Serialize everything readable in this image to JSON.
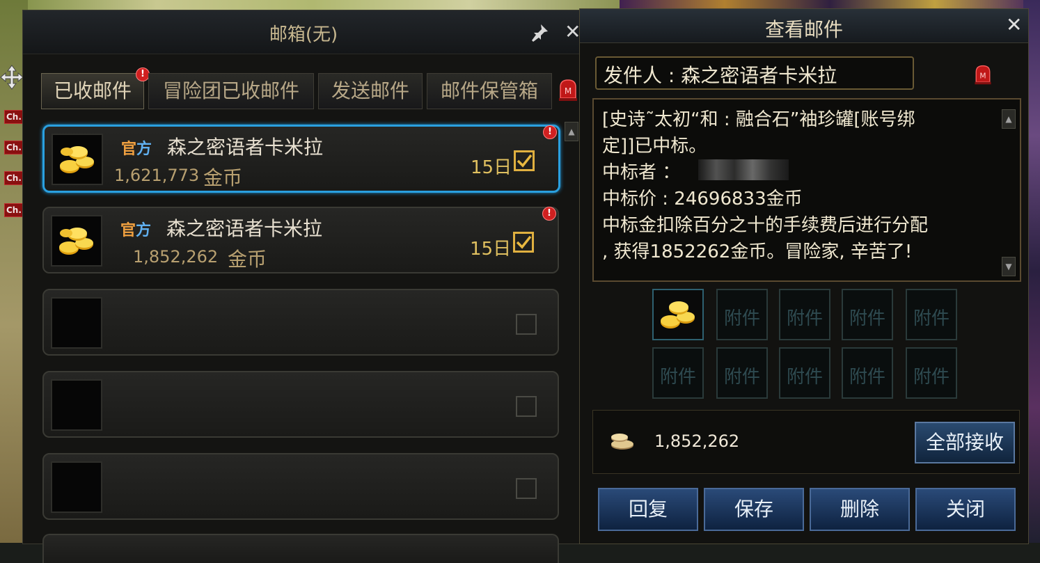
{
  "left_tags": [
    "Ch.",
    "Ch.",
    "Ch.",
    "Ch."
  ],
  "mailbox": {
    "title": "邮箱(无)",
    "tabs": [
      {
        "label": "已收邮件",
        "active": true,
        "badge": "!"
      },
      {
        "label": "冒险团已收邮件",
        "active": false
      },
      {
        "label": "发送邮件",
        "active": false
      },
      {
        "label": "邮件保管箱",
        "active": false
      }
    ],
    "mails": [
      {
        "official_a": "官",
        "official_b": "方",
        "sender": "森之密语者卡米拉",
        "amount": "1,621,773",
        "unit": "金币",
        "days": "15日",
        "badge": "!",
        "selected": true
      },
      {
        "official_a": "官",
        "official_b": "方",
        "sender": "森之密语者卡米拉",
        "amount": "1,852,262",
        "unit": "金币",
        "days": "15日",
        "badge": "!",
        "selected": false
      }
    ]
  },
  "viewmail": {
    "title": "查看邮件",
    "sender_label": "发件人 : 森之密语者卡米拉",
    "content": "[史诗˜太初“和 : 融合石”袖珍罐[账号绑\n定]]已中标。\n 中标者 ：\n 中标价 : 24696833金币\n中标金扣除百分之十的手续费后进行分配\n, 获得1852262金币。冒险家, 辛苦了!",
    "attachment_label": "附件",
    "gold_amount": "1,852,262",
    "receive_all": "全部接收",
    "buttons": [
      "回复",
      "保存",
      "删除",
      "关闭"
    ]
  },
  "colors": {
    "accent_blue": "#2aa0e0",
    "gold_text": "#e0c060",
    "badge_red": "#d02020"
  }
}
